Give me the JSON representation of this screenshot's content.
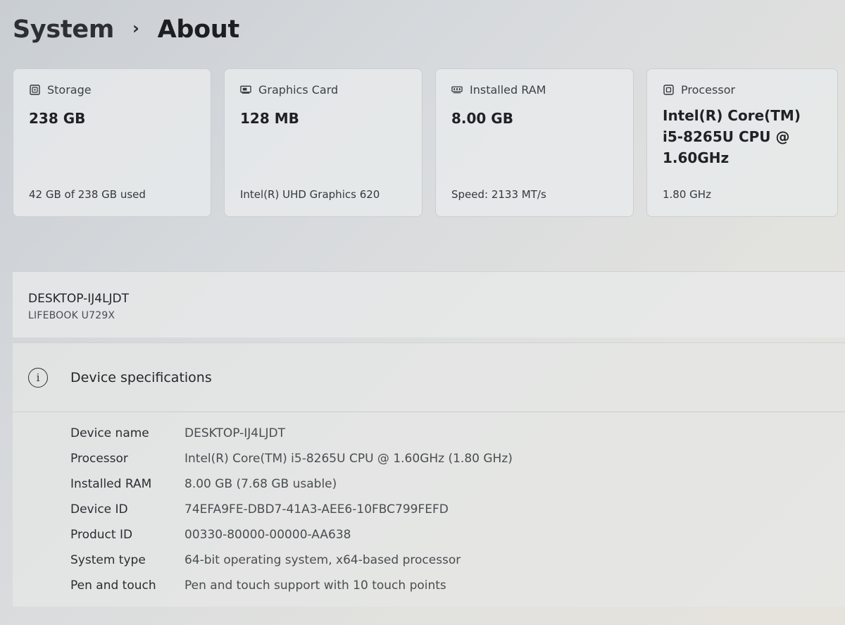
{
  "breadcrumb": {
    "parent": "System",
    "separator": "›",
    "current": "About"
  },
  "cards": [
    {
      "icon": "storage-icon",
      "label": "Storage",
      "value": "238 GB",
      "sub": "42 GB of 238 GB used"
    },
    {
      "icon": "graphics-card-icon",
      "label": "Graphics Card",
      "value": "128 MB",
      "sub": "Intel(R) UHD Graphics 620"
    },
    {
      "icon": "ram-icon",
      "label": "Installed RAM",
      "value": "8.00 GB",
      "sub": "Speed: 2133 MT/s"
    },
    {
      "icon": "processor-icon",
      "label": "Processor",
      "value": "Intel(R) Core(TM) i5-8265U CPU @ 1.60GHz",
      "sub": "1.80 GHz"
    }
  ],
  "device": {
    "name": "DESKTOP-IJ4LJDT",
    "model": "LIFEBOOK U729X"
  },
  "specs": {
    "title": "Device specifications",
    "icon": "info-icon",
    "rows": [
      {
        "label": "Device name",
        "value": "DESKTOP-IJ4LJDT"
      },
      {
        "label": "Processor",
        "value": "Intel(R) Core(TM) i5-8265U CPU @ 1.60GHz (1.80 GHz)"
      },
      {
        "label": "Installed RAM",
        "value": "8.00 GB (7.68 GB usable)"
      },
      {
        "label": "Device ID",
        "value": "74EFA9FE-DBD7-41A3-AEE6-10FBC799FEFD"
      },
      {
        "label": "Product ID",
        "value": "00330-80000-00000-AA638"
      },
      {
        "label": "System type",
        "value": "64-bit operating system, x64-based processor"
      },
      {
        "label": "Pen and touch",
        "value": "Pen and touch support with 10 touch points"
      }
    ]
  }
}
